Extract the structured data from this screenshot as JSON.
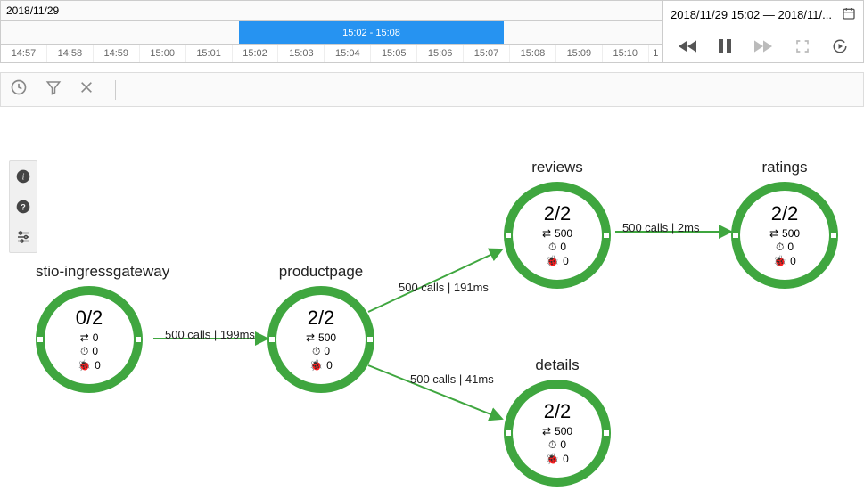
{
  "timeline": {
    "date": "2018/11/29",
    "selection_label": "15:02 - 15:08",
    "ticks": [
      "14:57",
      "14:58",
      "14:59",
      "15:00",
      "15:01",
      "15:02",
      "15:03",
      "15:04",
      "15:05",
      "15:06",
      "15:07",
      "15:08",
      "15:09",
      "15:10",
      "1"
    ],
    "range_text": "2018/11/29 15:02 — 2018/11/..."
  },
  "nodes": {
    "gateway": {
      "label": "stio-ingressgateway",
      "ratio": "0/2",
      "calls": "0",
      "latency": "0",
      "errors": "0"
    },
    "productpage": {
      "label": "productpage",
      "ratio": "2/2",
      "calls": "500",
      "latency": "0",
      "errors": "0"
    },
    "reviews": {
      "label": "reviews",
      "ratio": "2/2",
      "calls": "500",
      "latency": "0",
      "errors": "0"
    },
    "details": {
      "label": "details",
      "ratio": "2/2",
      "calls": "500",
      "latency": "0",
      "errors": "0"
    },
    "ratings": {
      "label": "ratings",
      "ratio": "2/2",
      "calls": "500",
      "latency": "0",
      "errors": "0"
    }
  },
  "edges": {
    "gw_pp": "500 calls | 199ms",
    "pp_rev": "500 calls | 191ms",
    "pp_det": "500 calls | 41ms",
    "rev_rat": "500 calls | 2ms"
  }
}
